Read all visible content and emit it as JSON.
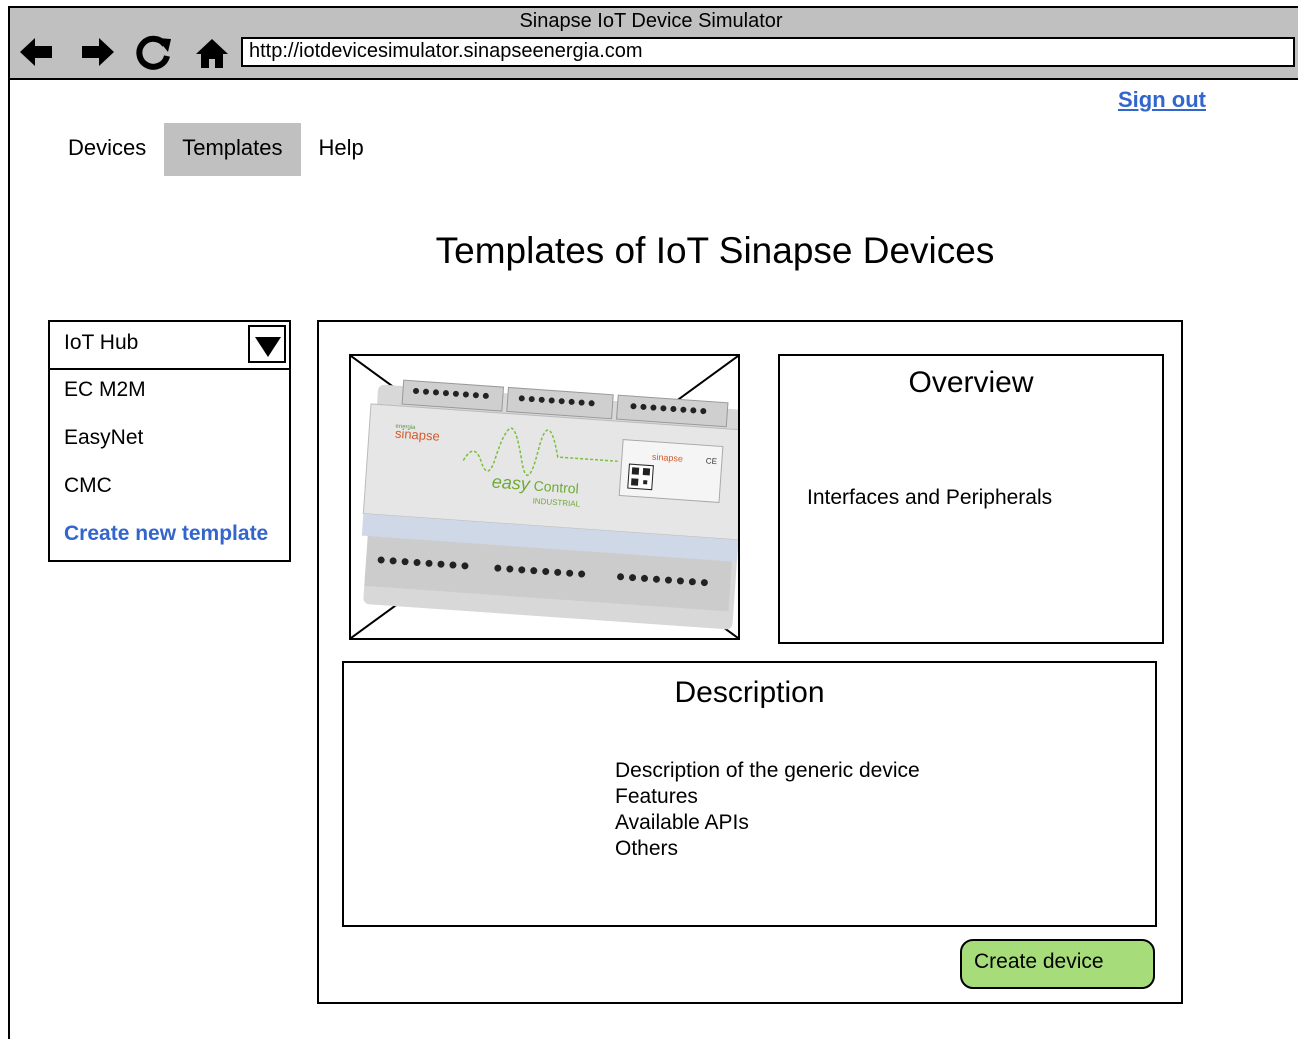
{
  "window": {
    "title": "Sinapse IoT Device Simulator"
  },
  "toolbar": {
    "back_icon": "arrow-left-icon",
    "forward_icon": "arrow-right-icon",
    "reload_icon": "reload-icon",
    "home_icon": "home-icon",
    "url": "http://iotdevicesimulator.sinapseenergia.com"
  },
  "header": {
    "sign_out": "Sign out"
  },
  "tabs": [
    {
      "label": "Devices",
      "active": false
    },
    {
      "label": "Templates",
      "active": true
    },
    {
      "label": "Help",
      "active": false
    }
  ],
  "page": {
    "title": "Templates of IoT Sinapse Devices"
  },
  "template_selector": {
    "selected": "IoT Hub",
    "options": [
      "EC M2M",
      "EasyNet",
      "CMC"
    ],
    "create_label": "Create new template"
  },
  "device_image": {
    "brand": "sinapse",
    "brand_sub": "energia",
    "product_easy": "easy",
    "product_control": "Control",
    "product_line": "INDUSTRIAL",
    "label_brand": "sinapse",
    "ce_mark": "CE"
  },
  "overview": {
    "title": "Overview",
    "body": "Interfaces and Peripherals"
  },
  "description": {
    "title": "Description",
    "lines": [
      "Description of the generic device",
      "Features",
      "Available APIs",
      "Others"
    ]
  },
  "actions": {
    "create_device": "Create device"
  },
  "colors": {
    "link": "#3366cc",
    "tab_active": "#c0c0c0",
    "create_button": "#a6dd7a",
    "chrome": "#c0c0c0"
  }
}
